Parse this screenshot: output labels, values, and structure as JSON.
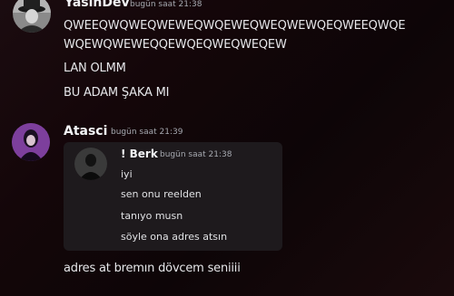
{
  "messages": [
    {
      "author": "YasinDev",
      "timestamp": "bugün saat 21:38",
      "avatar_icon": "man-in-hat-avatar-icon",
      "lines": [
        "QWEEQWQWEQWEWEQWQEWEQWEQWEWQEQWEEQWQE",
        "WQEWQWEWEQQEWQEQWEQWEQEW",
        "LAN OLMM",
        "BU ADAM ŞAKA MI"
      ]
    },
    {
      "author": "Atasci",
      "timestamp": "bugün saat 21:39",
      "avatar_icon": "purple-figure-avatar-icon",
      "embed": {
        "author": "! Berk",
        "timestamp": "bugün saat 21:38",
        "avatar_icon": "dark-figure-avatar-icon",
        "lines": [
          "iyi",
          "sen onu reelden",
          "tanıyo musn",
          "söyle ona adres atsın"
        ]
      },
      "lines": [
        "adres at bremın dövcem seniiii"
      ]
    }
  ],
  "colors": {
    "background": "#12070a",
    "text": "#e6e7ea",
    "muted": "#a6a9b0",
    "embed_bg": "#1e1a1d"
  }
}
